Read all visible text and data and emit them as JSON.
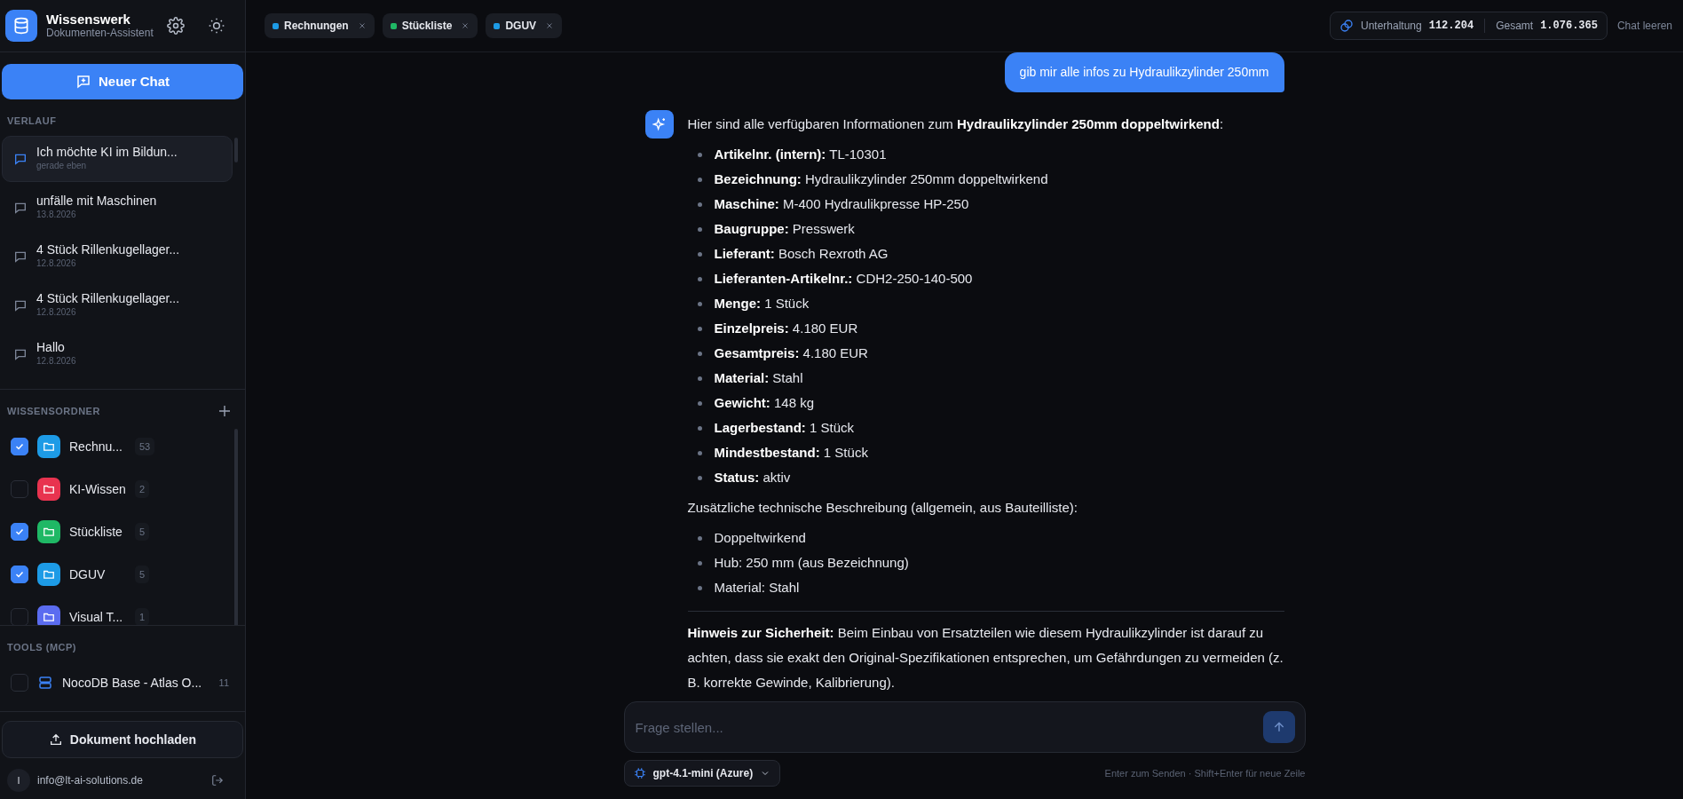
{
  "app": {
    "title": "Wissenswerk",
    "subtitle": "Dokumenten-Assistent"
  },
  "new_chat_button": "Neuer Chat",
  "history": {
    "heading": "VERLAUF",
    "items": [
      {
        "title": "Ich möchte KI im Bildun...",
        "time": "gerade eben",
        "selected": true
      },
      {
        "title": "unfälle mit Maschinen",
        "time": "13.8.2026",
        "selected": false
      },
      {
        "title": "4 Stück Rillenkugellager...",
        "time": "12.8.2026",
        "selected": false
      },
      {
        "title": "4 Stück Rillenkugellager...",
        "time": "12.8.2026",
        "selected": false
      },
      {
        "title": "Hallo",
        "time": "12.8.2026",
        "selected": false
      }
    ]
  },
  "folders": {
    "heading": "WISSENSORDNER",
    "items": [
      {
        "name": "Rechnu...",
        "count": "53",
        "checked": true,
        "color": "#1d9be6"
      },
      {
        "name": "KI-Wissen",
        "count": "2",
        "checked": false,
        "color": "#e8334f"
      },
      {
        "name": "Stückliste",
        "count": "5",
        "checked": true,
        "color": "#1fb865"
      },
      {
        "name": "DGUV",
        "count": "5",
        "checked": true,
        "color": "#1d9be6"
      },
      {
        "name": "Visual T...",
        "count": "1",
        "checked": false,
        "color": "#5b6cf0"
      }
    ]
  },
  "tools": {
    "heading": "TOOLS (MCP)",
    "items": [
      {
        "name": "NocoDB Base - Atlas O...",
        "count": "11",
        "checked": false
      }
    ]
  },
  "upload_button": "Dokument hochladen",
  "user": {
    "initial": "I",
    "email": "info@lt-ai-solutions.de"
  },
  "filter_chips": [
    {
      "label": "Rechnungen",
      "color": "#1d9be6"
    },
    {
      "label": "Stückliste",
      "color": "#1fb865"
    },
    {
      "label": "DGUV",
      "color": "#1d9be6"
    }
  ],
  "token_usage": {
    "conversation_label": "Unterhaltung",
    "conversation_value": "112.204",
    "total_label": "Gesamt",
    "total_value": "1.076.365"
  },
  "clear_chat": "Chat leeren",
  "messages": [
    {
      "kind": "user",
      "text": "gib mir alle infos zu Hydraulikzylinder 250mm"
    },
    {
      "kind": "assistant",
      "blocks": [
        {
          "kind": "paragraph",
          "text": "Hier sind alle verfügbaren Informationen zum **Hydraulikzylinder 250mm doppeltwirkend**:"
        },
        {
          "kind": "list",
          "items": [
            "**Artikelnr. (intern):** TL-10301",
            "**Bezeichnung:** Hydraulikzylinder 250mm doppeltwirkend",
            "**Maschine:** M-400 Hydraulikpresse HP-250",
            "**Baugruppe:** Presswerk",
            "**Lieferant:** Bosch Rexroth AG",
            "**Lieferanten-Artikelnr.:** CDH2-250-140-500",
            "**Menge:** 1 Stück",
            "**Einzelpreis:** 4.180 EUR",
            "**Gesamtpreis:** 4.180 EUR",
            "**Material:** Stahl",
            "**Gewicht:** 148 kg",
            "**Lagerbestand:** 1 Stück",
            "**Mindestbestand:** 1 Stück",
            "**Status:** aktiv"
          ]
        },
        {
          "kind": "paragraph",
          "text": "Zusätzliche technische Beschreibung (allgemein, aus Bauteilliste):"
        },
        {
          "kind": "list",
          "items": [
            "Doppeltwirkend",
            "Hub: 250 mm (aus Bezeichnung)",
            "Material: Stahl"
          ]
        },
        {
          "kind": "rule"
        },
        {
          "kind": "paragraph",
          "text": "**Hinweis zur Sicherheit:** Beim Einbau von Ersatzteilen wie diesem Hydraulikzylinder ist darauf zu achten, dass sie exakt den Original-Spezifikationen entsprechen, um Gefährdungen zu vermeiden (z. B. korrekte Gewinde, Kalibrierung)."
        }
      ]
    }
  ],
  "composer": {
    "placeholder": "Frage stellen...",
    "model": "gpt-4.1-mini (Azure)",
    "hint": "Enter zum Senden · Shift+Enter für neue Zeile"
  }
}
